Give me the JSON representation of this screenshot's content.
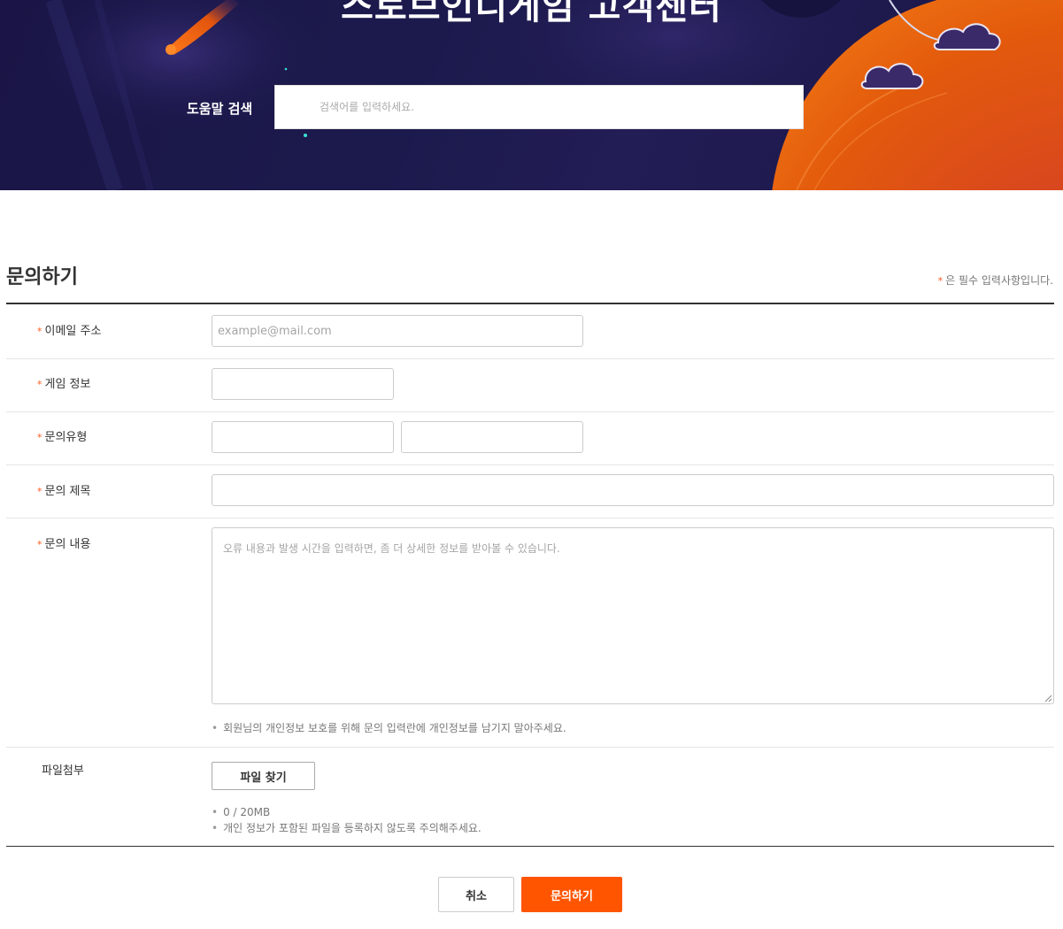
{
  "hero": {
    "title": "스토브인디게임 고객센터",
    "search_label": "도움말 검색",
    "search_placeholder": "검색어를 입력하세요."
  },
  "form": {
    "title": "문의하기",
    "required_note": "은 필수 입력사항입니다.",
    "required_marker": "*",
    "email": {
      "label": "이메일 주소",
      "placeholder": "example@mail.com",
      "value": ""
    },
    "game_info": {
      "label": "게임 정보",
      "value": ""
    },
    "inquiry_type": {
      "label": "문의유형",
      "primary_value": "",
      "secondary_value": ""
    },
    "subject": {
      "label": "문의 제목",
      "value": ""
    },
    "content": {
      "label": "문의 내용",
      "placeholder": "오류 내용과 발생 시간을 입력하면, 좀 더 상세한 정보를 받아볼 수 있습니다.",
      "privacy_note": "회원님의 개인정보 보호를 위해 문의 입력란에 개인정보를 남기지 말아주세요."
    },
    "attachment": {
      "label": "파일첨부",
      "button_label": "파일 찾기",
      "size_note": "0 / 20MB",
      "privacy_note": "개인 정보가 포함된 파일을 등록하지 않도록 주의해주세요."
    }
  },
  "actions": {
    "cancel_label": "취소",
    "submit_label": "문의하기"
  },
  "colors": {
    "accent": "#ff5500",
    "required_star": "#ff5a1f",
    "hero_background": "#1c1a4d"
  }
}
